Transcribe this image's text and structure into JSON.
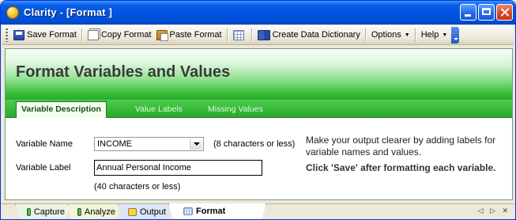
{
  "window": {
    "title": "Clarity - [Format  ]"
  },
  "toolbar": {
    "save_format": "Save Format",
    "copy_format": "Copy Format",
    "paste_format": "Paste Format",
    "create_data_dictionary": "Create Data Dictionary",
    "options": "Options",
    "help": "Help"
  },
  "banner": {
    "title": "Format Variables and Values"
  },
  "tabs": [
    {
      "label": "Variable Description",
      "active": true
    },
    {
      "label": "Value Labels",
      "active": false
    },
    {
      "label": "Missing Values",
      "active": false
    }
  ],
  "form": {
    "variable_name_label": "Variable Name",
    "variable_name_value": "INCOME",
    "variable_name_hint": "(8 characters or less)",
    "variable_label_label": "Variable Label",
    "variable_label_value": "Annual Personal Income",
    "variable_label_hint": "(40 characters or less)"
  },
  "help": {
    "text": "Make your output clearer by adding labels for variable names and values.",
    "save_note": "Click 'Save' after formatting each variable."
  },
  "bottom_tabs": [
    {
      "label": "Capture",
      "icon": "capture-icon"
    },
    {
      "label": "Analyze",
      "icon": "analyze-icon"
    },
    {
      "label": "Output",
      "icon": "output-icon"
    },
    {
      "label": "Format",
      "icon": "format-icon",
      "active": true
    }
  ],
  "nav": {
    "arrows": "◁ ▷ ✕"
  }
}
